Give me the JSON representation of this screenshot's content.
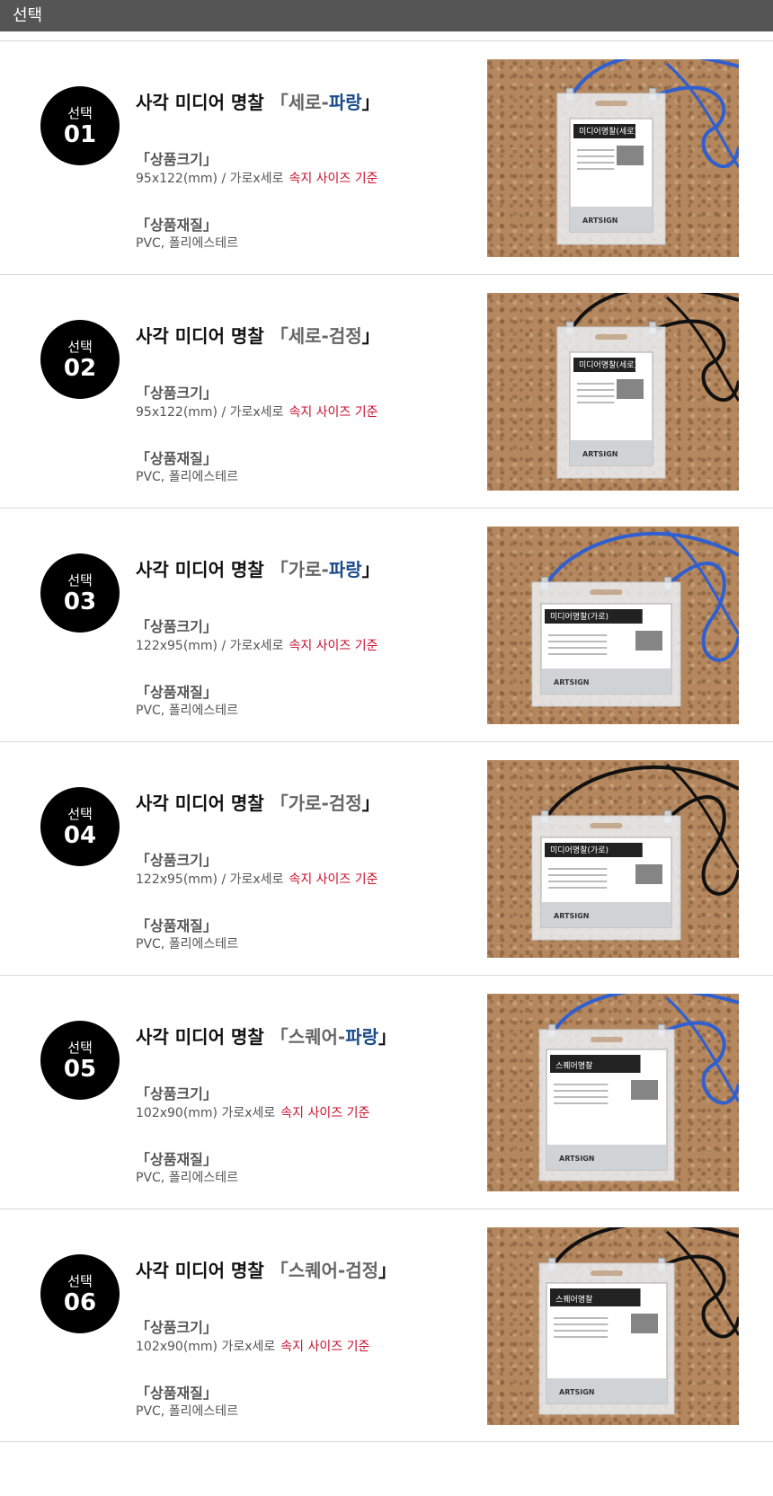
{
  "header": {
    "title": "선택"
  },
  "labels": {
    "select": "선택",
    "size_label": "「상품크기」",
    "material_label": "「상품재질」",
    "note": "속지 사이즈 기준",
    "material_value": "PVC, 폴리에스테르",
    "title_prefix": "사각 미디어 명찰",
    "bracket_open": "「",
    "bracket_close": "」",
    "dash": "-"
  },
  "colors": {
    "header_bg": "#555555",
    "accent_blue": "#1a4a8a",
    "note_red": "#c8102e",
    "strap_blue": "#2f5fd0",
    "strap_black": "#111111"
  },
  "items": [
    {
      "num": "01",
      "type": "세로",
      "color": "파랑",
      "size": "95x122(mm) / 가로x세로",
      "strap": "blue",
      "orientation": "portrait",
      "card_title": "미디어명찰(세로)",
      "brand": "ARTSIGN"
    },
    {
      "num": "02",
      "type": "세로",
      "color": "검정",
      "size": "95x122(mm) / 가로x세로",
      "strap": "black",
      "orientation": "portrait",
      "card_title": "미디어명찰(세로)",
      "brand": "ARTSIGN"
    },
    {
      "num": "03",
      "type": "가로",
      "color": "파랑",
      "size": "122x95(mm) / 가로x세로",
      "strap": "blue",
      "orientation": "landscape",
      "card_title": "미디어명찰(가로)",
      "brand": "ARTSIGN"
    },
    {
      "num": "04",
      "type": "가로",
      "color": "검정",
      "size": "122x95(mm) / 가로x세로",
      "strap": "black",
      "orientation": "landscape",
      "card_title": "미디어명찰(가로)",
      "brand": "ARTSIGN"
    },
    {
      "num": "05",
      "type": "스퀘어",
      "color": "파랑",
      "size": "102x90(mm) 가로x세로",
      "strap": "blue",
      "orientation": "square",
      "card_title": "스퀘어명찰",
      "brand": "ARTSIGN"
    },
    {
      "num": "06",
      "type": "스퀘어",
      "color": "검정",
      "size": "102x90(mm) 가로x세로",
      "strap": "black",
      "orientation": "square",
      "card_title": "스퀘어명찰",
      "brand": "ARTSIGN"
    }
  ]
}
